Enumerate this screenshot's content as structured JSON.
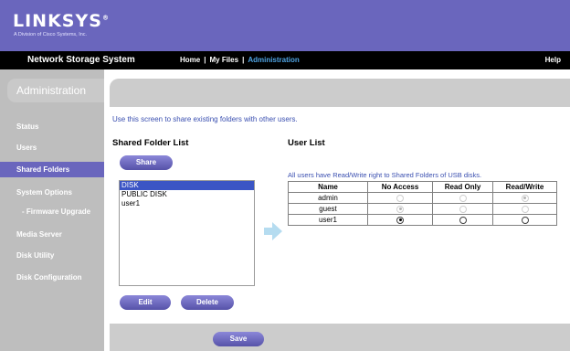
{
  "header": {
    "logo": "LINKSYS",
    "logo_suffix": "®",
    "tagline": "A Division of Cisco Systems, Inc."
  },
  "nav": {
    "title": "Network Storage System",
    "links": [
      "Home",
      "My Files",
      "Administration"
    ],
    "active_link": "Administration",
    "help": "Help"
  },
  "sidebar": {
    "title": "Administration",
    "items": [
      {
        "label": "Status"
      },
      {
        "label": "Users"
      },
      {
        "label": "Shared Folders",
        "active": true
      },
      {
        "label": "System Options"
      },
      {
        "label": "- Firmware Upgrade"
      },
      {
        "label": "Media Server"
      },
      {
        "label": "Disk Utility"
      },
      {
        "label": "Disk Configuration"
      }
    ]
  },
  "main": {
    "intro": "Use this screen to share existing folders with other users.",
    "shared_folder_list": {
      "heading": "Shared Folder List",
      "share_button": "Share",
      "folders": [
        "DISK",
        "PUBLIC DISK",
        "user1"
      ],
      "selected_folder": "DISK",
      "edit_button": "Edit",
      "delete_button": "Delete"
    },
    "user_list": {
      "heading": "User List",
      "note": "All users have Read/Write right to Shared Folders of USB disks.",
      "columns": [
        "Name",
        "No Access",
        "Read Only",
        "Read/Write"
      ],
      "rows": [
        {
          "name": "admin",
          "permission": "Read/Write",
          "disabled": true
        },
        {
          "name": "guest",
          "permission": "No Access",
          "disabled": true
        },
        {
          "name": "user1",
          "permission": "No Access",
          "disabled": false
        }
      ]
    },
    "save_button": "Save"
  },
  "colors": {
    "brand_purple": "#6a66bd",
    "nav_active": "#4fa3e3",
    "sidebar_gray": "#bebebe",
    "content_gray": "#cccccc",
    "selected_blue": "#3b55c5",
    "intro_text": "#3a4fb0"
  }
}
